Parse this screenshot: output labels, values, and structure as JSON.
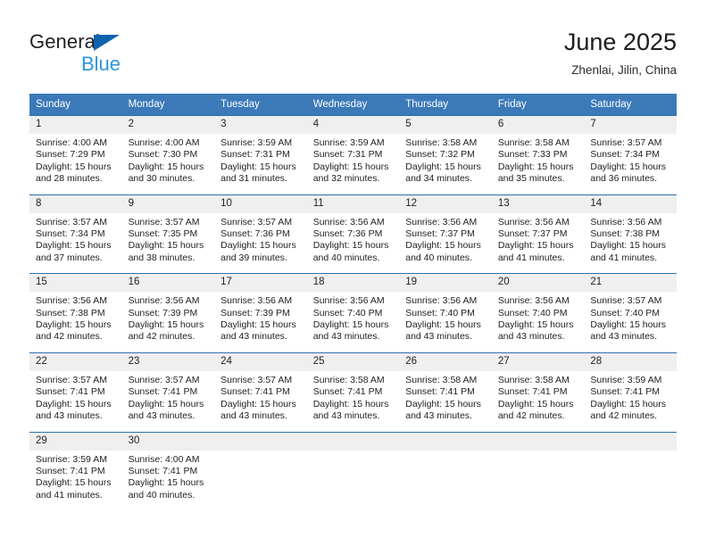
{
  "brand": {
    "name_top": "General",
    "name_bottom": "Blue",
    "accent_color": "#2e96d9",
    "triangle_color": "#0f63ad"
  },
  "header": {
    "title": "June 2025",
    "location": "Zhenlai, Jilin, China"
  },
  "calendar": {
    "header_bg": "#3b79b8",
    "daynum_bg": "#efefef",
    "weekday_headers": [
      "Sunday",
      "Monday",
      "Tuesday",
      "Wednesday",
      "Thursday",
      "Friday",
      "Saturday"
    ],
    "weeks": [
      [
        {
          "day": "1",
          "sunrise": "Sunrise: 4:00 AM",
          "sunset": "Sunset: 7:29 PM",
          "daylight_1": "Daylight: 15 hours",
          "daylight_2": "and 28 minutes."
        },
        {
          "day": "2",
          "sunrise": "Sunrise: 4:00 AM",
          "sunset": "Sunset: 7:30 PM",
          "daylight_1": "Daylight: 15 hours",
          "daylight_2": "and 30 minutes."
        },
        {
          "day": "3",
          "sunrise": "Sunrise: 3:59 AM",
          "sunset": "Sunset: 7:31 PM",
          "daylight_1": "Daylight: 15 hours",
          "daylight_2": "and 31 minutes."
        },
        {
          "day": "4",
          "sunrise": "Sunrise: 3:59 AM",
          "sunset": "Sunset: 7:31 PM",
          "daylight_1": "Daylight: 15 hours",
          "daylight_2": "and 32 minutes."
        },
        {
          "day": "5",
          "sunrise": "Sunrise: 3:58 AM",
          "sunset": "Sunset: 7:32 PM",
          "daylight_1": "Daylight: 15 hours",
          "daylight_2": "and 34 minutes."
        },
        {
          "day": "6",
          "sunrise": "Sunrise: 3:58 AM",
          "sunset": "Sunset: 7:33 PM",
          "daylight_1": "Daylight: 15 hours",
          "daylight_2": "and 35 minutes."
        },
        {
          "day": "7",
          "sunrise": "Sunrise: 3:57 AM",
          "sunset": "Sunset: 7:34 PM",
          "daylight_1": "Daylight: 15 hours",
          "daylight_2": "and 36 minutes."
        }
      ],
      [
        {
          "day": "8",
          "sunrise": "Sunrise: 3:57 AM",
          "sunset": "Sunset: 7:34 PM",
          "daylight_1": "Daylight: 15 hours",
          "daylight_2": "and 37 minutes."
        },
        {
          "day": "9",
          "sunrise": "Sunrise: 3:57 AM",
          "sunset": "Sunset: 7:35 PM",
          "daylight_1": "Daylight: 15 hours",
          "daylight_2": "and 38 minutes."
        },
        {
          "day": "10",
          "sunrise": "Sunrise: 3:57 AM",
          "sunset": "Sunset: 7:36 PM",
          "daylight_1": "Daylight: 15 hours",
          "daylight_2": "and 39 minutes."
        },
        {
          "day": "11",
          "sunrise": "Sunrise: 3:56 AM",
          "sunset": "Sunset: 7:36 PM",
          "daylight_1": "Daylight: 15 hours",
          "daylight_2": "and 40 minutes."
        },
        {
          "day": "12",
          "sunrise": "Sunrise: 3:56 AM",
          "sunset": "Sunset: 7:37 PM",
          "daylight_1": "Daylight: 15 hours",
          "daylight_2": "and 40 minutes."
        },
        {
          "day": "13",
          "sunrise": "Sunrise: 3:56 AM",
          "sunset": "Sunset: 7:37 PM",
          "daylight_1": "Daylight: 15 hours",
          "daylight_2": "and 41 minutes."
        },
        {
          "day": "14",
          "sunrise": "Sunrise: 3:56 AM",
          "sunset": "Sunset: 7:38 PM",
          "daylight_1": "Daylight: 15 hours",
          "daylight_2": "and 41 minutes."
        }
      ],
      [
        {
          "day": "15",
          "sunrise": "Sunrise: 3:56 AM",
          "sunset": "Sunset: 7:38 PM",
          "daylight_1": "Daylight: 15 hours",
          "daylight_2": "and 42 minutes."
        },
        {
          "day": "16",
          "sunrise": "Sunrise: 3:56 AM",
          "sunset": "Sunset: 7:39 PM",
          "daylight_1": "Daylight: 15 hours",
          "daylight_2": "and 42 minutes."
        },
        {
          "day": "17",
          "sunrise": "Sunrise: 3:56 AM",
          "sunset": "Sunset: 7:39 PM",
          "daylight_1": "Daylight: 15 hours",
          "daylight_2": "and 43 minutes."
        },
        {
          "day": "18",
          "sunrise": "Sunrise: 3:56 AM",
          "sunset": "Sunset: 7:40 PM",
          "daylight_1": "Daylight: 15 hours",
          "daylight_2": "and 43 minutes."
        },
        {
          "day": "19",
          "sunrise": "Sunrise: 3:56 AM",
          "sunset": "Sunset: 7:40 PM",
          "daylight_1": "Daylight: 15 hours",
          "daylight_2": "and 43 minutes."
        },
        {
          "day": "20",
          "sunrise": "Sunrise: 3:56 AM",
          "sunset": "Sunset: 7:40 PM",
          "daylight_1": "Daylight: 15 hours",
          "daylight_2": "and 43 minutes."
        },
        {
          "day": "21",
          "sunrise": "Sunrise: 3:57 AM",
          "sunset": "Sunset: 7:40 PM",
          "daylight_1": "Daylight: 15 hours",
          "daylight_2": "and 43 minutes."
        }
      ],
      [
        {
          "day": "22",
          "sunrise": "Sunrise: 3:57 AM",
          "sunset": "Sunset: 7:41 PM",
          "daylight_1": "Daylight: 15 hours",
          "daylight_2": "and 43 minutes."
        },
        {
          "day": "23",
          "sunrise": "Sunrise: 3:57 AM",
          "sunset": "Sunset: 7:41 PM",
          "daylight_1": "Daylight: 15 hours",
          "daylight_2": "and 43 minutes."
        },
        {
          "day": "24",
          "sunrise": "Sunrise: 3:57 AM",
          "sunset": "Sunset: 7:41 PM",
          "daylight_1": "Daylight: 15 hours",
          "daylight_2": "and 43 minutes."
        },
        {
          "day": "25",
          "sunrise": "Sunrise: 3:58 AM",
          "sunset": "Sunset: 7:41 PM",
          "daylight_1": "Daylight: 15 hours",
          "daylight_2": "and 43 minutes."
        },
        {
          "day": "26",
          "sunrise": "Sunrise: 3:58 AM",
          "sunset": "Sunset: 7:41 PM",
          "daylight_1": "Daylight: 15 hours",
          "daylight_2": "and 43 minutes."
        },
        {
          "day": "27",
          "sunrise": "Sunrise: 3:58 AM",
          "sunset": "Sunset: 7:41 PM",
          "daylight_1": "Daylight: 15 hours",
          "daylight_2": "and 42 minutes."
        },
        {
          "day": "28",
          "sunrise": "Sunrise: 3:59 AM",
          "sunset": "Sunset: 7:41 PM",
          "daylight_1": "Daylight: 15 hours",
          "daylight_2": "and 42 minutes."
        }
      ],
      [
        {
          "day": "29",
          "sunrise": "Sunrise: 3:59 AM",
          "sunset": "Sunset: 7:41 PM",
          "daylight_1": "Daylight: 15 hours",
          "daylight_2": "and 41 minutes."
        },
        {
          "day": "30",
          "sunrise": "Sunrise: 4:00 AM",
          "sunset": "Sunset: 7:41 PM",
          "daylight_1": "Daylight: 15 hours",
          "daylight_2": "and 40 minutes."
        },
        {
          "day": "",
          "sunrise": "",
          "sunset": "",
          "daylight_1": "",
          "daylight_2": ""
        },
        {
          "day": "",
          "sunrise": "",
          "sunset": "",
          "daylight_1": "",
          "daylight_2": ""
        },
        {
          "day": "",
          "sunrise": "",
          "sunset": "",
          "daylight_1": "",
          "daylight_2": ""
        },
        {
          "day": "",
          "sunrise": "",
          "sunset": "",
          "daylight_1": "",
          "daylight_2": ""
        },
        {
          "day": "",
          "sunrise": "",
          "sunset": "",
          "daylight_1": "",
          "daylight_2": ""
        }
      ]
    ]
  }
}
